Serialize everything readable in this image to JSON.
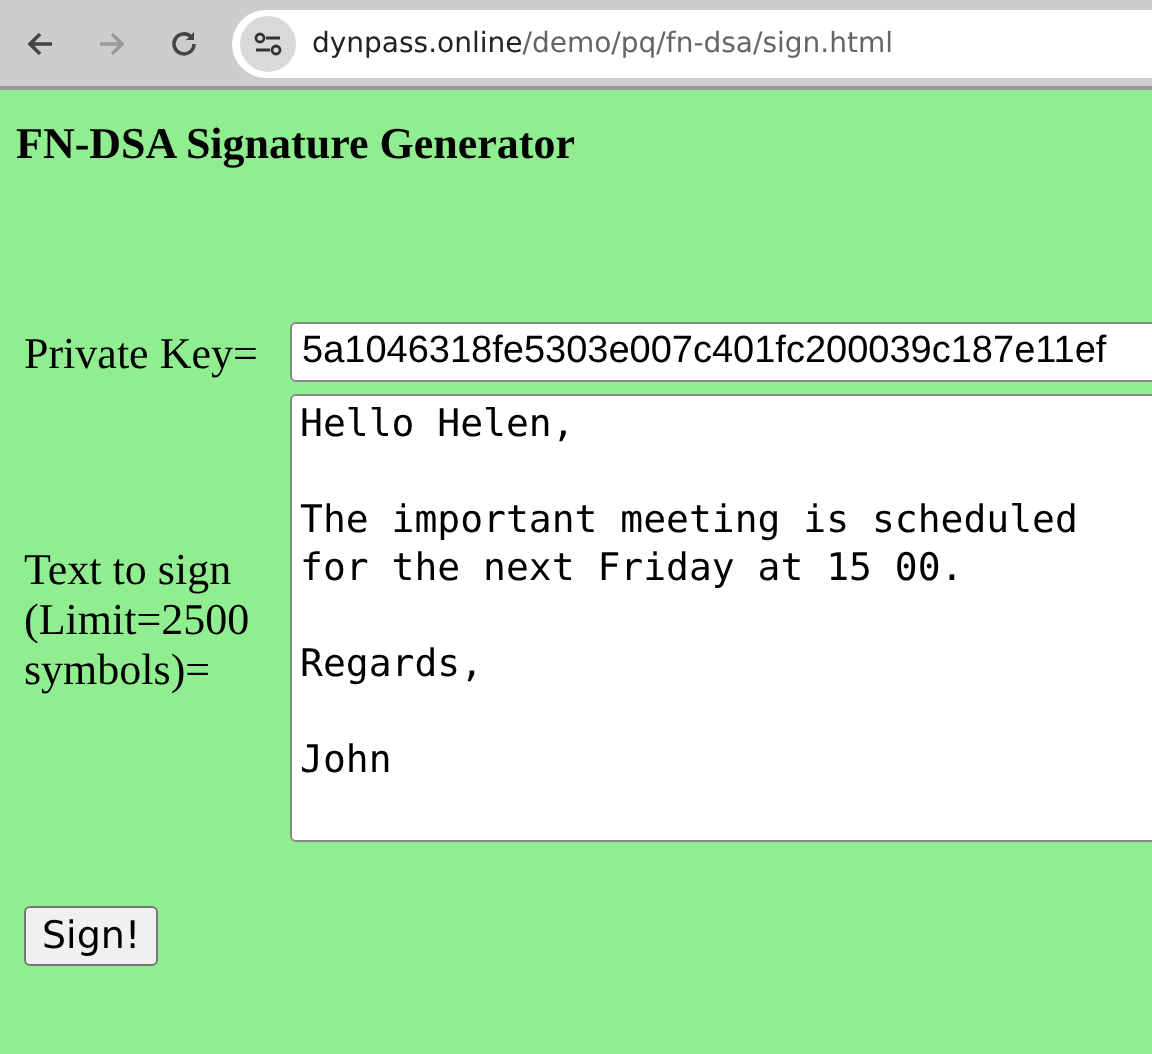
{
  "browser": {
    "url_host": "dynpass.online",
    "url_path": "/demo/pq/fn-dsa/sign.html"
  },
  "title": "FN-DSA Signature Generator",
  "form": {
    "private_key": {
      "label": "Private Key=",
      "value": "5a1046318fe5303e007c401fc200039c187e11ef"
    },
    "text": {
      "label": "Text to sign (Limit=2500 symbols)=",
      "value": "Hello Helen,\n\nThe important meeting is scheduled\nfor the next Friday at 15 00.\n\nRegards,\n\nJohn"
    }
  },
  "buttons": [
    "Sign!"
  ]
}
